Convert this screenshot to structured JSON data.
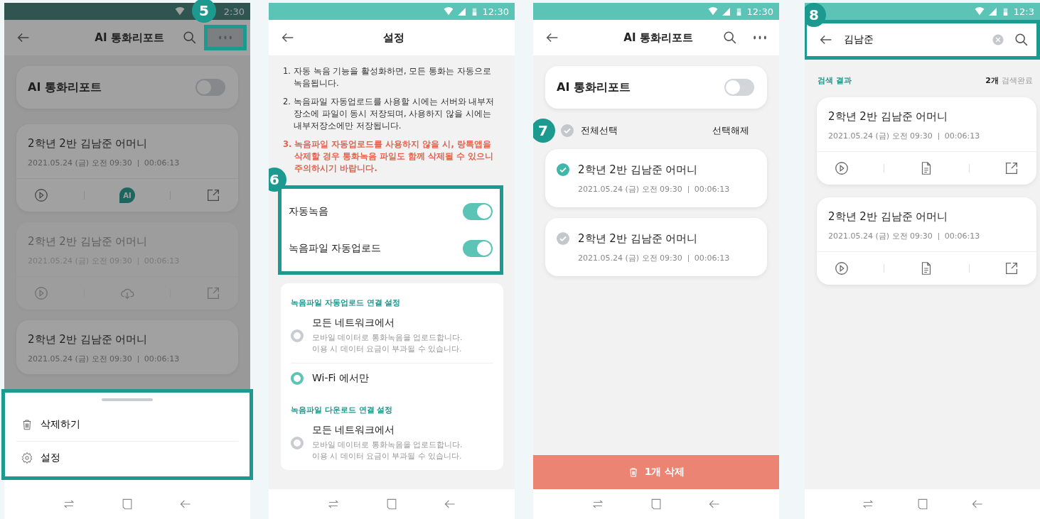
{
  "screens": [
    {
      "kind": "report_list",
      "dimmed": true,
      "status_bar": {
        "time": "2:30"
      },
      "app_bar": {
        "title": "AI 통화리포트",
        "actions": [
          {
            "kind": "search",
            "highlighted": false
          },
          {
            "kind": "more",
            "highlighted": true,
            "badge": "5"
          }
        ]
      },
      "feature_toggle": {
        "label": "AI 통화리포트",
        "on": false
      },
      "calls": [
        {
          "title": "2학년 2반 김남준 어머니",
          "datetime": "2021.05.24 (금) 오전 09:30",
          "duration": "00:06:13",
          "disabled": false,
          "actions": [
            {
              "kind": "play"
            },
            {
              "kind": "ai",
              "label": "AI"
            },
            {
              "kind": "share"
            }
          ]
        },
        {
          "title": "2학년 2반 김남준 어머니",
          "datetime": "2021.05.24 (금) 오전 09:30",
          "duration": "00:06:13",
          "disabled": true,
          "actions": [
            {
              "kind": "play"
            },
            {
              "kind": "download"
            },
            {
              "kind": "share"
            }
          ]
        },
        {
          "title": "2학년 2반 김남준 어머니",
          "datetime": "2021.05.24 (금) 오전 09:30",
          "duration": "00:06:13",
          "disabled": false
        }
      ],
      "sheet": {
        "highlighted": true,
        "items": [
          {
            "kind": "delete",
            "label": "삭제하기"
          },
          {
            "kind": "settings",
            "label": "설정"
          }
        ]
      }
    },
    {
      "kind": "settings",
      "status_bar": {
        "time": "12:30"
      },
      "app_bar": {
        "title": "설정"
      },
      "notes": [
        {
          "number": "1.",
          "text": "자동 녹음 기능을 활성화하면, 모든 통화는 자동으로 녹음됩니다.",
          "warning": false
        },
        {
          "number": "2.",
          "text": "녹음파일 자동업로드를 사용할 시에는 서버와 내부저장소에 파일이 동시 저장되며, 사용하지 않을 시에는 내부저장소에만 저장됩니다.",
          "warning": false
        },
        {
          "number": "3.",
          "text": "녹음파일 자동업로드를 사용하지 않을 시, 랑톡앱을 삭제할 경우 통화녹음 파일도 함께 삭제될 수 있으니 주의하시기 바랍니다.",
          "warning": true
        }
      ],
      "toggles": {
        "highlighted": true,
        "badge": "6",
        "items": [
          {
            "label": "자동녹음",
            "on": true
          },
          {
            "label": "녹음파일 자동업로드",
            "on": true
          }
        ]
      },
      "sections": [
        {
          "title": "녹음파일 자동업로드 연결 설정",
          "options": [
            {
              "label": "모든 네트워크에서",
              "description": "모바일 데이터로 통화녹음을 업로드합니다.\n이용 시 데이터 요금이 부과될 수 있습니다.",
              "selected": false
            },
            {
              "label": "Wi-Fi 에서만",
              "selected": true
            }
          ]
        },
        {
          "title": "녹음파일 다운로드 연결 설정",
          "options": [
            {
              "label": "모든 네트워크에서",
              "description": "모바일 데이터로 통화녹음을 업로드합니다.\n이용 시 데이터 요금이 부과될 수 있습니다.",
              "selected": false
            }
          ]
        }
      ]
    },
    {
      "kind": "select_list",
      "status_bar": {
        "time": "12:30"
      },
      "app_bar": {
        "title": "AI 통화리포트",
        "actions": [
          {
            "kind": "search",
            "highlighted": false
          },
          {
            "kind": "more",
            "highlighted": false
          }
        ]
      },
      "feature_toggle": {
        "label": "AI 통화리포트",
        "on": false
      },
      "select_all": {
        "label": "전체선택",
        "checked": false,
        "badge": "7",
        "clear_label": "선택해제"
      },
      "calls": [
        {
          "title": "2학년 2반 김남준 어머니",
          "datetime": "2021.05.24 (금) 오전 09:30",
          "duration": "00:06:13",
          "selected": true
        },
        {
          "title": "2학년 2반 김남준 어머니",
          "datetime": "2021.05.24 (금) 오전 09:30",
          "duration": "00:06:13",
          "selected": false
        }
      ],
      "delete_button": {
        "label": "1개 삭제"
      }
    },
    {
      "kind": "search",
      "status_bar": {
        "time": "12:3"
      },
      "search_bar": {
        "value": "김남준",
        "highlighted": true,
        "badge": "8"
      },
      "results_header": {
        "title": "검색 결과",
        "count": "2개",
        "status": "검색완료"
      },
      "calls": [
        {
          "title": "2학년 2반 김남준 어머니",
          "datetime": "2021.05.24 (금) 오전 09:30",
          "duration": "00:06:13",
          "disabled": false,
          "actions": [
            {
              "kind": "play"
            },
            {
              "kind": "document"
            },
            {
              "kind": "share"
            }
          ]
        },
        {
          "title": "2학년 2반 김남준 어머니",
          "datetime": "2021.05.24 (금) 오전 09:30",
          "duration": "00:06:13",
          "disabled": false,
          "actions": [
            {
              "kind": "play"
            },
            {
              "kind": "document"
            },
            {
              "kind": "share"
            }
          ]
        }
      ]
    }
  ]
}
